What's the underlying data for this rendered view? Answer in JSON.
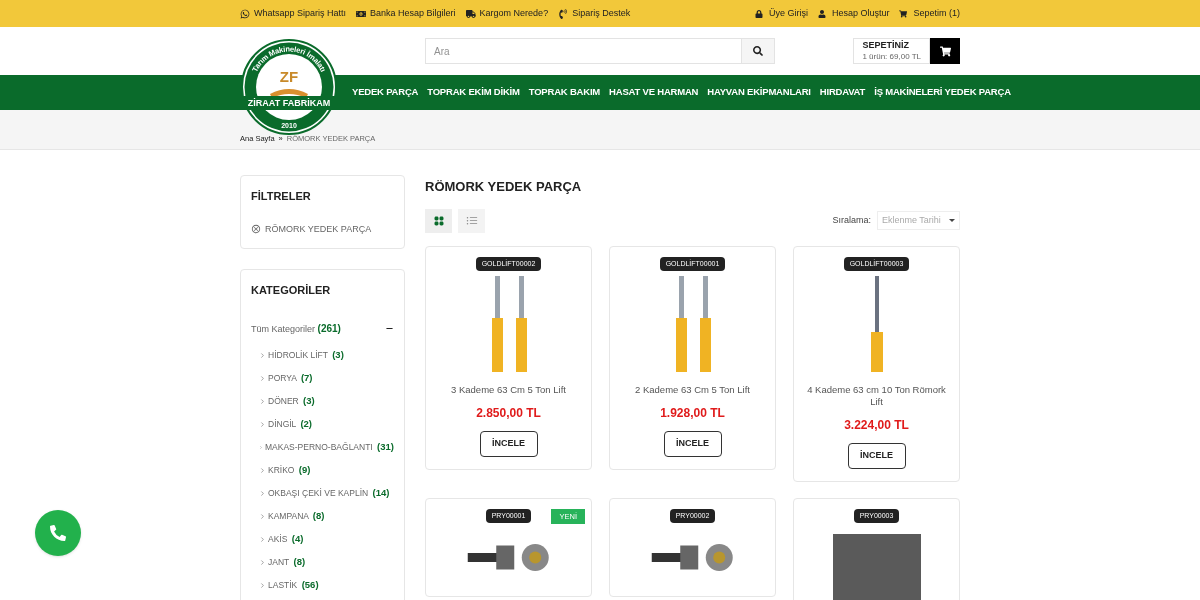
{
  "top_bar": {
    "left_links": [
      {
        "label": "Whatsapp Sipariş Hattı"
      },
      {
        "label": "Banka Hesap Bilgileri"
      },
      {
        "label": "Kargom Nerede?"
      },
      {
        "label": "Sipariş Destek"
      }
    ],
    "right_links": [
      {
        "label": "Üye Girişi"
      },
      {
        "label": "Hesap Oluştur"
      },
      {
        "label": "Sepetim (1)"
      }
    ]
  },
  "logo": {
    "monogram": "ZF",
    "arc_text": "Tarım Makineleri İmalatı",
    "name": "ZİRAAT FABRİKAM",
    "year": "2010"
  },
  "search": {
    "placeholder": "Ara"
  },
  "cart": {
    "title": "SEPETİNİZ",
    "summary": "1 ürün: 69,00 TL"
  },
  "nav": [
    {
      "label": "YEDEK PARÇA"
    },
    {
      "label": "TOPRAK EKİM DİKİM"
    },
    {
      "label": "TOPRAK BAKIM"
    },
    {
      "label": "HASAT VE HARMAN"
    },
    {
      "label": "HAYVAN EKİPMANLARI"
    },
    {
      "label": "HIRDAVAT"
    },
    {
      "label": "İŞ MAKİNELERİ YEDEK PARÇA"
    }
  ],
  "breadcrumb": [
    {
      "label": "Ana Sayfa"
    },
    {
      "label": "RÖMORK YEDEK PARÇA"
    }
  ],
  "breadcrumb_separator": "»",
  "filters": {
    "title": "FİLTRELER",
    "active": [
      {
        "label": "RÖMORK YEDEK PARÇA"
      }
    ]
  },
  "categories": {
    "title": "KATEGORİLER",
    "root": {
      "label": "Tüm Kategoriler",
      "count": "(261)",
      "expanded": true,
      "children": [
        {
          "label": "HİDROLİK LİFT",
          "count": "(3)"
        },
        {
          "label": "PORYA",
          "count": "(7)"
        },
        {
          "label": "DÖNER",
          "count": "(3)"
        },
        {
          "label": "DİNGİL",
          "count": "(2)"
        },
        {
          "label": "MAKAS-PERNO-BAĞLANTI",
          "count": "(31)"
        },
        {
          "label": "KRİKO",
          "count": "(9)"
        },
        {
          "label": "OKBAŞI ÇEKİ VE KAPLİN",
          "count": "(14)"
        },
        {
          "label": "KAMPANA",
          "count": "(8)"
        },
        {
          "label": "AKİS",
          "count": "(4)"
        },
        {
          "label": "JANT",
          "count": "(8)"
        },
        {
          "label": "LASTİK",
          "count": "(56)"
        }
      ]
    }
  },
  "page_title": "RÖMORK YEDEK PARÇA",
  "view_modes": [
    {
      "kind": "grid",
      "selected": true
    },
    {
      "kind": "list",
      "selected": false
    }
  ],
  "sort": {
    "label": "Sıralama:",
    "value": "Eklenme Tarihi"
  },
  "products": [
    {
      "code": "GOLDLİFT00002",
      "kind": "double-lift",
      "name": "3 Kademe 63 Cm 5 Ton Lift",
      "price": "2.850,00 TL",
      "button": "İNCELE"
    },
    {
      "code": "GOLDLİFT00001",
      "kind": "double-lift",
      "name": "2 Kademe 63 Cm 5 Ton Lift",
      "price": "1.928,00 TL",
      "button": "İNCELE"
    },
    {
      "code": "GOLDLİFT00003",
      "kind": "single-lift",
      "name": "4 Kademe 63 cm 10 Ton Römork Lift",
      "price": "3.224,00 TL",
      "button": "İNCELE"
    },
    {
      "code": "PRY00001",
      "kind": "hub",
      "badge": "YENİ"
    },
    {
      "code": "PRY00002",
      "kind": "hub"
    },
    {
      "code": "PRY00003",
      "kind": "photo"
    }
  ]
}
